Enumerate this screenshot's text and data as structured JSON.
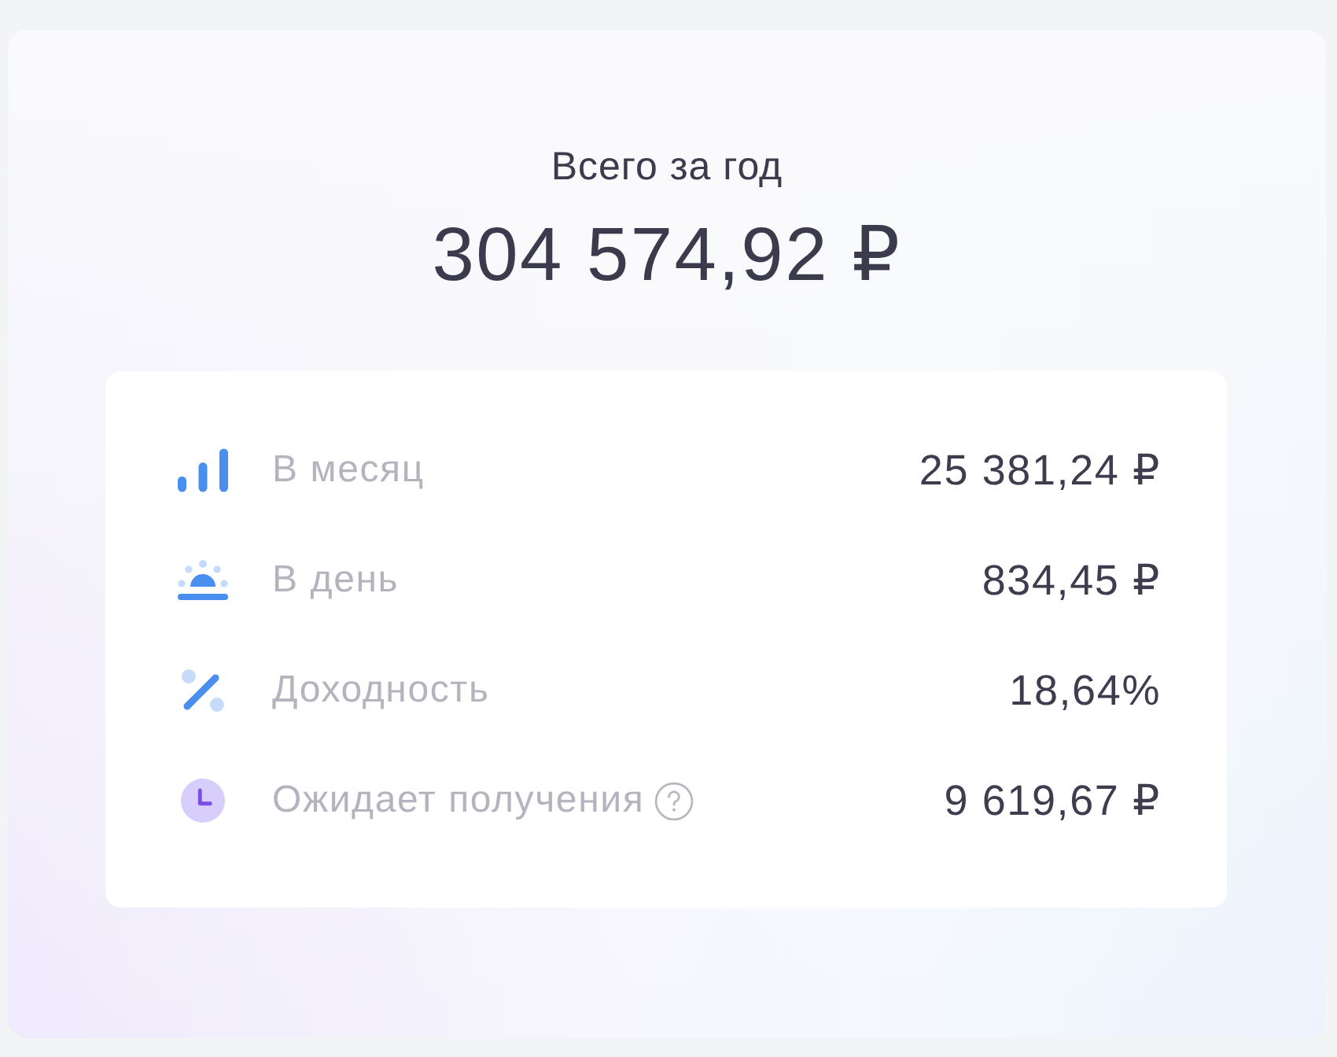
{
  "summary": {
    "title": "Всего за год",
    "total": "304 574,92 ₽"
  },
  "rows": [
    {
      "kind": "bars",
      "label": "В месяц",
      "help": false,
      "value": "25 381,24 ₽"
    },
    {
      "kind": "sunrise",
      "label": "В день",
      "help": false,
      "value": "834,45 ₽"
    },
    {
      "kind": "percent",
      "label": "Доходность",
      "help": false,
      "value": "18,64%"
    },
    {
      "kind": "clock",
      "label": "Ожидает получения",
      "help": true,
      "value": "9 619,67 ₽"
    }
  ]
}
